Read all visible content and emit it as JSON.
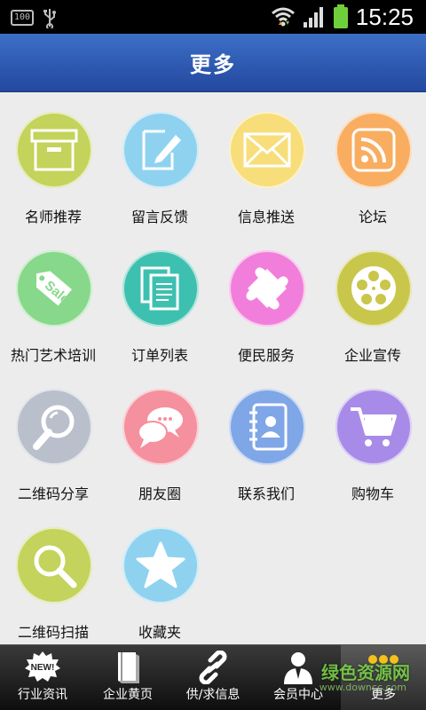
{
  "status_bar": {
    "battery_small": "100",
    "time": "15:25"
  },
  "title": "更多",
  "grid_items": [
    {
      "label": "名师推荐",
      "icon": "box-icon",
      "color": "#c3d35b"
    },
    {
      "label": "留言反馈",
      "icon": "edit-note-icon",
      "color": "#8fd2ef"
    },
    {
      "label": "信息推送",
      "icon": "envelope-icon",
      "color": "#f7de7a"
    },
    {
      "label": "论坛",
      "icon": "rss-icon",
      "color": "#f9ad61"
    },
    {
      "label": "热门艺术培训",
      "icon": "sale-tag-icon",
      "color": "#87d88a"
    },
    {
      "label": "订单列表",
      "icon": "documents-icon",
      "color": "#3ec0b0"
    },
    {
      "label": "便民服务",
      "icon": "puzzle-icon",
      "color": "#f27edb"
    },
    {
      "label": "企业宣传",
      "icon": "film-reel-icon",
      "color": "#c9c64c"
    },
    {
      "label": "二维码分享",
      "icon": "magnifier-icon",
      "color": "#b9c0cb"
    },
    {
      "label": "朋友圈",
      "icon": "chat-bubbles-icon",
      "color": "#f5909e"
    },
    {
      "label": "联系我们",
      "icon": "contact-book-icon",
      "color": "#7fa6e6"
    },
    {
      "label": "购物车",
      "icon": "shopping-cart-icon",
      "color": "#a88be8"
    },
    {
      "label": "二维码扫描",
      "icon": "search-icon",
      "color": "#c3d35b"
    },
    {
      "label": "收藏夹",
      "icon": "star-icon",
      "color": "#8fd2ef"
    }
  ],
  "tabs": [
    {
      "label": "行业资讯",
      "icon": "new-badge-icon"
    },
    {
      "label": "企业黄页",
      "icon": "book-icon"
    },
    {
      "label": "供/求信息",
      "icon": "link-icon"
    },
    {
      "label": "会员中心",
      "icon": "member-icon"
    },
    {
      "label": "更多",
      "icon": "more-dots-icon",
      "active": true
    }
  ],
  "watermark": {
    "text": "绿色资源网",
    "sub": "www.downcc.com"
  }
}
